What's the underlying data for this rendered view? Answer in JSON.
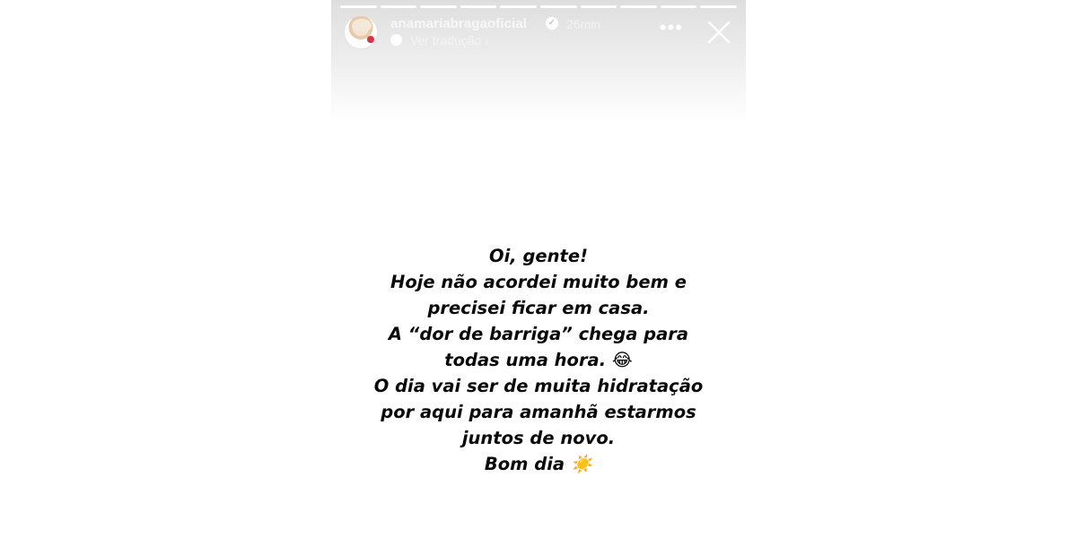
{
  "story": {
    "progress_segments": 10,
    "username": "anamariabragaoficial",
    "verified_icon": "verified-badge-icon",
    "time": "26min",
    "translate_label": "Ver tradução",
    "more_icon": "more-options-icon",
    "close_icon": "close-icon",
    "message_lines": [
      "Oi, gente!",
      "Hoje não acordei muito bem e",
      "precisei ficar em casa.",
      "A “dor de barriga” chega para",
      "todas uma hora. 😂",
      "O dia vai ser de muita hidratação",
      "por aqui para amanhã estarmos",
      "juntos de novo.",
      "Bom dia ☀️"
    ]
  }
}
